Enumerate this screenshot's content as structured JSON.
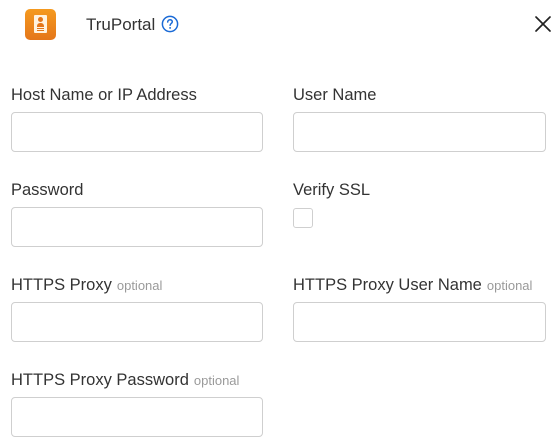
{
  "header": {
    "title": "TruPortal",
    "icon": "truportal-app-icon",
    "help_icon": "help-circle-icon",
    "close_icon": "close-icon",
    "accent_color": "#1a6ad6",
    "app_icon_color": "#f08a1c"
  },
  "form": {
    "host": {
      "label": "Host Name or IP Address",
      "value": "",
      "placeholder": ""
    },
    "username": {
      "label": "User Name",
      "value": "",
      "placeholder": ""
    },
    "password": {
      "label": "Password",
      "value": "",
      "placeholder": ""
    },
    "verify_ssl": {
      "label": "Verify SSL",
      "checked": false
    },
    "proxy": {
      "label": "HTTPS Proxy",
      "optional": "optional",
      "value": "",
      "placeholder": ""
    },
    "proxy_username": {
      "label": "HTTPS Proxy User Name",
      "optional": "optional",
      "value": "",
      "placeholder": ""
    },
    "proxy_password": {
      "label": "HTTPS Proxy Password",
      "optional": "optional",
      "value": "",
      "placeholder": ""
    }
  }
}
